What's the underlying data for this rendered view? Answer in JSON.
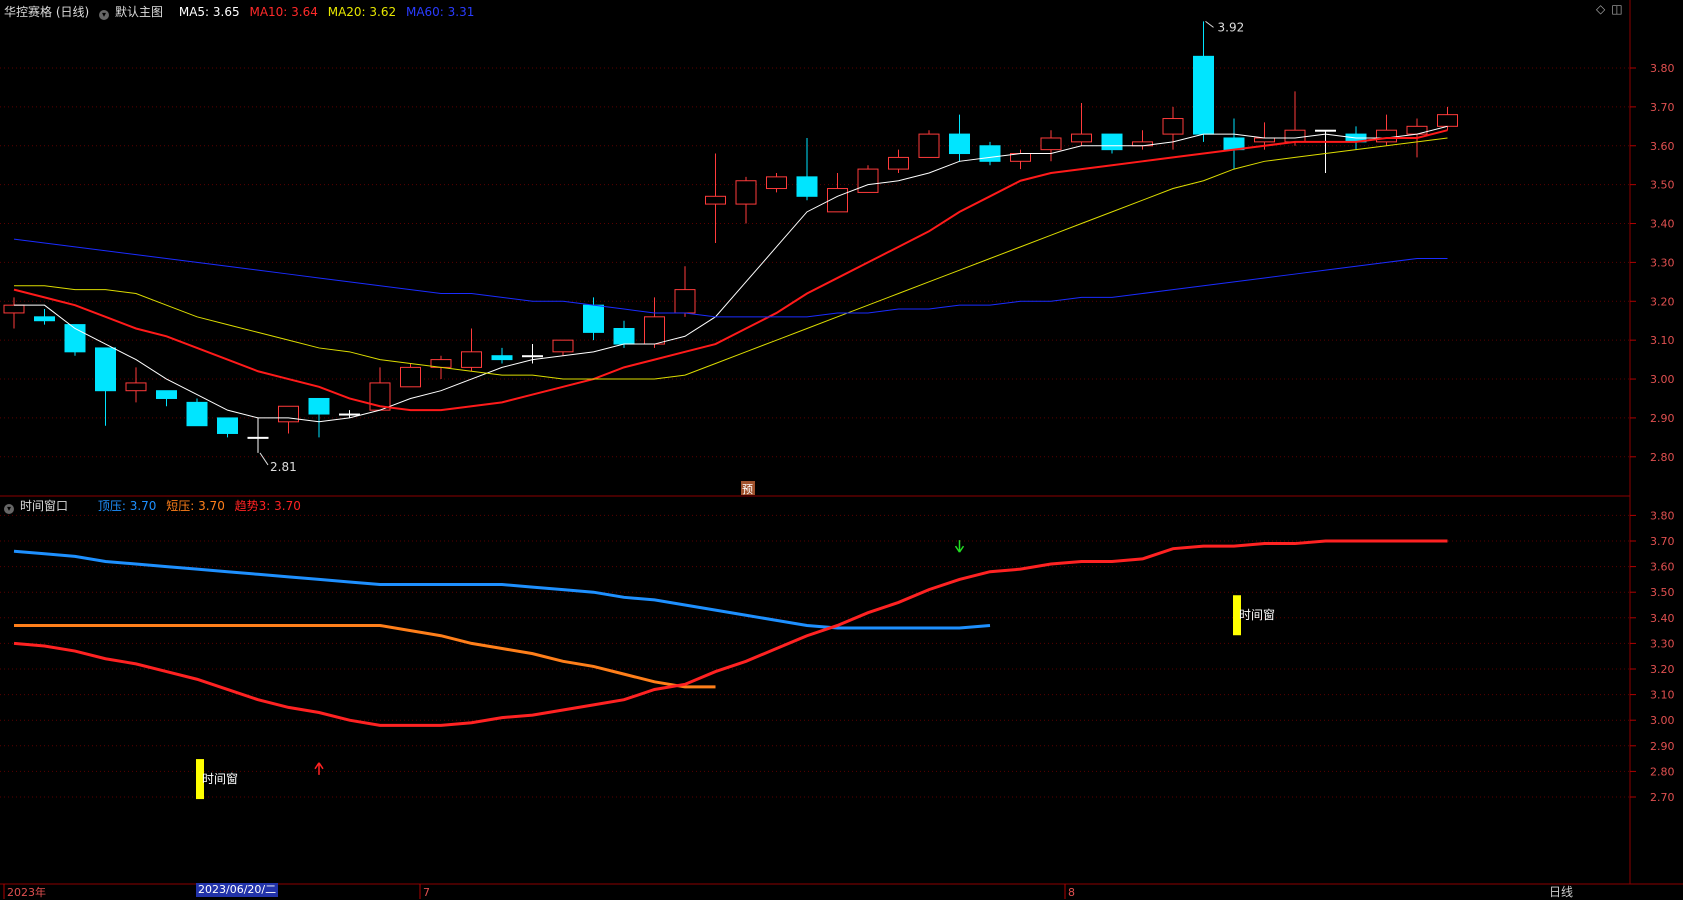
{
  "main": {
    "title": "华控赛格 (日线)",
    "template": "默认主图",
    "ma": [
      {
        "label": "MA5: 3.65",
        "color": "#ffffff"
      },
      {
        "label": "MA10: 3.64",
        "color": "#ff2a2a"
      },
      {
        "label": "MA20: 3.62",
        "color": "#e6e600"
      },
      {
        "label": "MA60: 3.31",
        "color": "#1a2cff"
      }
    ],
    "y_ticks": [
      "3.80",
      "3.70",
      "3.60",
      "3.50",
      "3.40",
      "3.30",
      "3.20",
      "3.10",
      "3.00",
      "2.90",
      "2.80"
    ],
    "high_label": "3.92",
    "low_label": "2.81",
    "forecast_mark": "预"
  },
  "sub": {
    "title": "时间窗口",
    "lines": [
      {
        "label": "顶压: 3.70",
        "color": "#1e90ff"
      },
      {
        "label": "短压: 3.70",
        "color": "#ff7f1a"
      },
      {
        "label": "趋势3: 3.70",
        "color": "#ff2222"
      }
    ],
    "y_ticks": [
      "3.80",
      "3.70",
      "3.60",
      "3.50",
      "3.40",
      "3.30",
      "3.20",
      "3.10",
      "3.00",
      "2.90",
      "2.80",
      "2.70"
    ],
    "window_label": "时间窗"
  },
  "x_axis": {
    "labels": [
      "2023年",
      "7",
      "8"
    ],
    "cursor_date": "2023/06/20/二",
    "period": "日线"
  },
  "chart_data": [
    {
      "type": "candlestick",
      "title": "华控赛格 (日线)",
      "ylim": [
        2.76,
        3.92
      ],
      "candles": [
        [
          3.17,
          3.19,
          3.13,
          3.21
        ],
        [
          3.16,
          3.15,
          3.14,
          3.18
        ],
        [
          3.14,
          3.07,
          3.06,
          3.14
        ],
        [
          3.08,
          2.97,
          2.88,
          3.08
        ],
        [
          2.97,
          2.99,
          2.94,
          3.03
        ],
        [
          2.97,
          2.95,
          2.93,
          2.97
        ],
        [
          2.94,
          2.88,
          2.88,
          2.95
        ],
        [
          2.9,
          2.86,
          2.85,
          2.9
        ],
        [
          2.85,
          2.85,
          2.81,
          2.9
        ],
        [
          2.89,
          2.93,
          2.86,
          2.93
        ],
        [
          2.95,
          2.91,
          2.85,
          2.95
        ],
        [
          2.91,
          2.91,
          2.9,
          2.92
        ],
        [
          2.92,
          2.99,
          2.92,
          3.03
        ],
        [
          2.98,
          3.03,
          2.98,
          3.04
        ],
        [
          3.03,
          3.05,
          3.0,
          3.06
        ],
        [
          3.03,
          3.07,
          3.02,
          3.13
        ],
        [
          3.06,
          3.05,
          3.04,
          3.08
        ],
        [
          3.06,
          3.06,
          3.04,
          3.09
        ],
        [
          3.07,
          3.1,
          3.06,
          3.1
        ],
        [
          3.19,
          3.12,
          3.1,
          3.21
        ],
        [
          3.13,
          3.09,
          3.08,
          3.15
        ],
        [
          3.09,
          3.16,
          3.08,
          3.21
        ],
        [
          3.17,
          3.23,
          3.16,
          3.29
        ],
        [
          3.45,
          3.47,
          3.35,
          3.58
        ],
        [
          3.45,
          3.51,
          3.4,
          3.52
        ],
        [
          3.49,
          3.52,
          3.48,
          3.53
        ],
        [
          3.52,
          3.47,
          3.46,
          3.62
        ],
        [
          3.43,
          3.49,
          3.43,
          3.53
        ],
        [
          3.48,
          3.54,
          3.48,
          3.55
        ],
        [
          3.54,
          3.57,
          3.53,
          3.59
        ],
        [
          3.57,
          3.63,
          3.57,
          3.64
        ],
        [
          3.63,
          3.58,
          3.56,
          3.68
        ],
        [
          3.6,
          3.56,
          3.55,
          3.61
        ],
        [
          3.56,
          3.58,
          3.54,
          3.59
        ],
        [
          3.59,
          3.62,
          3.56,
          3.64
        ],
        [
          3.61,
          3.63,
          3.6,
          3.71
        ],
        [
          3.63,
          3.59,
          3.58,
          3.63
        ],
        [
          3.6,
          3.61,
          3.59,
          3.64
        ],
        [
          3.63,
          3.67,
          3.59,
          3.7
        ],
        [
          3.83,
          3.63,
          3.61,
          3.92
        ],
        [
          3.62,
          3.59,
          3.54,
          3.67
        ],
        [
          3.61,
          3.62,
          3.59,
          3.66
        ],
        [
          3.61,
          3.64,
          3.6,
          3.74
        ],
        [
          3.64,
          3.64,
          3.53,
          3.64
        ],
        [
          3.63,
          3.61,
          3.59,
          3.65
        ],
        [
          3.61,
          3.64,
          3.6,
          3.68
        ],
        [
          3.63,
          3.65,
          3.57,
          3.67
        ],
        [
          3.65,
          3.68,
          3.64,
          3.7
        ]
      ],
      "series": [
        {
          "name": "MA5",
          "values": [
            3.19,
            3.19,
            3.13,
            3.09,
            3.05,
            3.0,
            2.96,
            2.92,
            2.9,
            2.9,
            2.89,
            2.9,
            2.92,
            2.95,
            2.97,
            3.0,
            3.03,
            3.05,
            3.06,
            3.07,
            3.09,
            3.09,
            3.11,
            3.16,
            3.25,
            3.34,
            3.43,
            3.47,
            3.5,
            3.51,
            3.53,
            3.56,
            3.57,
            3.58,
            3.58,
            3.6,
            3.6,
            3.6,
            3.61,
            3.63,
            3.63,
            3.62,
            3.62,
            3.63,
            3.62,
            3.62,
            3.63,
            3.65
          ]
        },
        {
          "name": "MA10",
          "values": [
            3.23,
            3.21,
            3.19,
            3.16,
            3.13,
            3.11,
            3.08,
            3.05,
            3.02,
            3.0,
            2.98,
            2.95,
            2.93,
            2.92,
            2.92,
            2.93,
            2.94,
            2.96,
            2.98,
            3.0,
            3.03,
            3.05,
            3.07,
            3.09,
            3.13,
            3.17,
            3.22,
            3.26,
            3.3,
            3.34,
            3.38,
            3.43,
            3.47,
            3.51,
            3.53,
            3.54,
            3.55,
            3.56,
            3.57,
            3.58,
            3.59,
            3.6,
            3.61,
            3.61,
            3.61,
            3.62,
            3.62,
            3.64
          ]
        },
        {
          "name": "MA20",
          "values": [
            3.24,
            3.24,
            3.23,
            3.23,
            3.22,
            3.19,
            3.16,
            3.14,
            3.12,
            3.1,
            3.08,
            3.07,
            3.05,
            3.04,
            3.03,
            3.02,
            3.01,
            3.01,
            3.0,
            3.0,
            3.0,
            3.0,
            3.01,
            3.04,
            3.07,
            3.1,
            3.13,
            3.16,
            3.19,
            3.22,
            3.25,
            3.28,
            3.31,
            3.34,
            3.37,
            3.4,
            3.43,
            3.46,
            3.49,
            3.51,
            3.54,
            3.56,
            3.57,
            3.58,
            3.59,
            3.6,
            3.61,
            3.62
          ]
        },
        {
          "name": "MA60",
          "values": [
            3.36,
            3.35,
            3.34,
            3.33,
            3.32,
            3.31,
            3.3,
            3.29,
            3.28,
            3.27,
            3.26,
            3.25,
            3.24,
            3.23,
            3.22,
            3.22,
            3.21,
            3.2,
            3.2,
            3.19,
            3.18,
            3.17,
            3.17,
            3.16,
            3.16,
            3.16,
            3.16,
            3.17,
            3.17,
            3.18,
            3.18,
            3.19,
            3.19,
            3.2,
            3.2,
            3.21,
            3.21,
            3.22,
            3.23,
            3.24,
            3.25,
            3.26,
            3.27,
            3.28,
            3.29,
            3.3,
            3.31,
            3.31
          ]
        }
      ]
    },
    {
      "type": "line",
      "title": "时间窗口",
      "ylim": [
        2.65,
        3.92
      ],
      "series": [
        {
          "name": "顶压",
          "values": [
            3.66,
            3.65,
            3.64,
            3.62,
            3.61,
            3.6,
            3.59,
            3.58,
            3.57,
            3.56,
            3.55,
            3.54,
            3.53,
            3.53,
            3.53,
            3.53,
            3.53,
            3.52,
            3.51,
            3.5,
            3.48,
            3.47,
            3.45,
            3.43,
            3.41,
            3.39,
            3.37,
            3.36,
            3.36,
            3.36,
            3.36,
            3.36,
            3.37
          ]
        },
        {
          "name": "短压",
          "values": [
            3.37,
            3.37,
            3.37,
            3.37,
            3.37,
            3.37,
            3.37,
            3.37,
            3.37,
            3.37,
            3.37,
            3.37,
            3.37,
            3.35,
            3.33,
            3.3,
            3.28,
            3.26,
            3.23,
            3.21,
            3.18,
            3.15,
            3.13,
            3.13
          ]
        },
        {
          "name": "趋势3",
          "values": [
            3.3,
            3.29,
            3.27,
            3.24,
            3.22,
            3.19,
            3.16,
            3.12,
            3.08,
            3.05,
            3.03,
            3.0,
            2.98,
            2.98,
            2.98,
            2.99,
            3.01,
            3.02,
            3.04,
            3.06,
            3.08,
            3.12,
            3.14,
            3.19,
            3.23,
            3.28,
            3.33,
            3.37,
            3.42,
            3.46,
            3.51,
            3.55,
            3.58,
            3.59,
            3.61,
            3.62,
            3.62,
            3.63,
            3.67,
            3.68,
            3.68,
            3.69,
            3.69,
            3.7,
            3.7,
            3.7,
            3.7,
            3.7
          ]
        }
      ],
      "markers": [
        {
          "type": "time-window",
          "value": 2.77,
          "x_index": 6
        },
        {
          "type": "time-window",
          "value": 3.41,
          "x_index": 40
        },
        {
          "type": "up-arrow",
          "value": 2.81,
          "x_index": 10
        },
        {
          "type": "down-arrow",
          "value": 3.68,
          "x_index": 31
        }
      ]
    }
  ]
}
